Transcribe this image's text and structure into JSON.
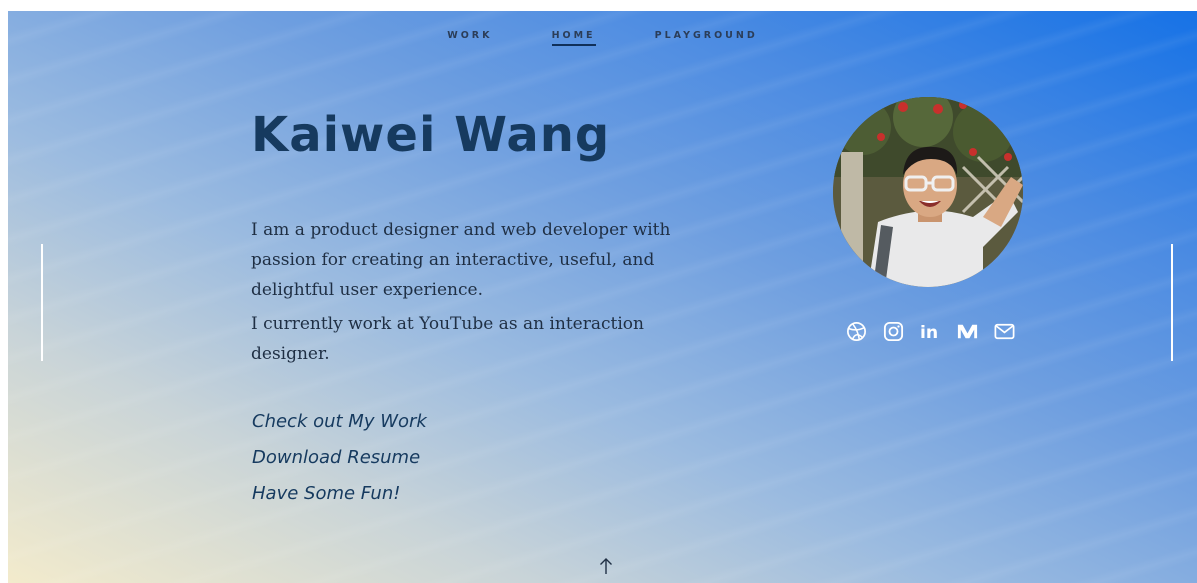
{
  "nav": {
    "items": [
      {
        "label": "WORK"
      },
      {
        "label": "HOME"
      },
      {
        "label": "PLAYGROUND"
      }
    ],
    "active": "HOME"
  },
  "hero": {
    "name": "Kaiwei Wang",
    "bio_1": "I am a product designer and web developer with passion for creating an interactive, useful, and delightful user experience.",
    "bio_2": "I currently work at YouTube as an interaction designer."
  },
  "links": {
    "work": "Check out My Work",
    "resume": "Download Resume",
    "fun": "Have Some Fun!"
  },
  "social": {
    "icons": [
      "dribbble-icon",
      "instagram-icon",
      "linkedin-icon",
      "medium-icon",
      "mail-icon"
    ],
    "linkedin_text": "in"
  },
  "colors": {
    "heading": "#163a5f",
    "text": "#1f2f44",
    "gradient_top_right": "#1672e6",
    "gradient_bottom_left": "#f3ebcc"
  }
}
